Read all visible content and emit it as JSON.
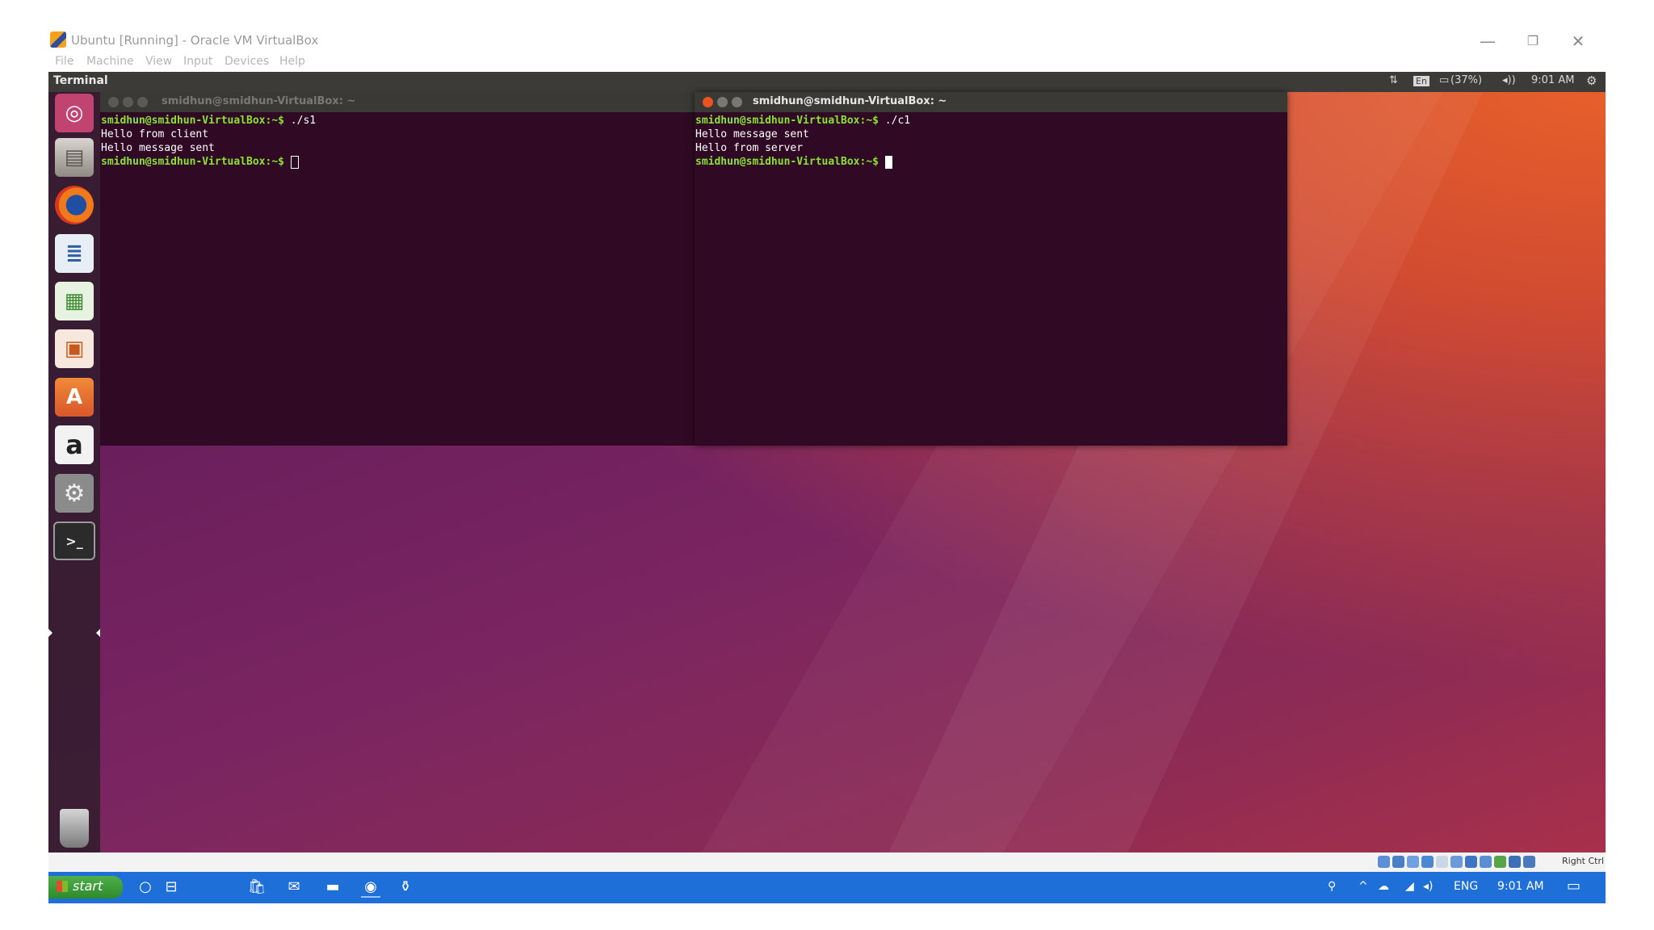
{
  "host_window": {
    "title": "Ubuntu [Running] - Oracle VM VirtualBox",
    "menu": [
      "File",
      "Machine",
      "View",
      "Input",
      "Devices",
      "Help"
    ],
    "controls": {
      "minimize": "—",
      "maximize": "❐",
      "close": "✕"
    }
  },
  "guest": {
    "topbar": {
      "app_title": "Terminal",
      "battery": "(37%)",
      "time": "9:01 AM"
    },
    "launcher": [
      "dash-home",
      "files",
      "firefox",
      "writer",
      "calc",
      "impress",
      "software-center",
      "amazon",
      "system-settings",
      "terminal",
      "trash"
    ],
    "terminals": [
      {
        "title": "smidhun@smidhun-VirtualBox: ~",
        "active": false,
        "lines": [
          {
            "prompt": "smidhun@smidhun-VirtualBox:~$",
            "cmd": " ./s1"
          },
          {
            "text": "Hello from client"
          },
          {
            "text": "Hello message sent"
          },
          {
            "prompt": "smidhun@smidhun-VirtualBox:~$",
            "cmd": " "
          }
        ]
      },
      {
        "title": "smidhun@smidhun-VirtualBox: ~",
        "active": true,
        "lines": [
          {
            "prompt": "smidhun@smidhun-VirtualBox:~$",
            "cmd": " ./c1"
          },
          {
            "text": "Hello message sent"
          },
          {
            "text": "Hello from server"
          },
          {
            "prompt": "smidhun@smidhun-VirtualBox:~$",
            "cmd": " "
          }
        ]
      }
    ]
  },
  "status_bar": {
    "host_key": "Right Ctrl"
  },
  "taskbar": {
    "start_label": "start",
    "tray": {
      "language": "ENG",
      "time": "9:01 AM"
    }
  },
  "colors": {
    "terminal_bg": "#300a24",
    "prompt": "#8ae234",
    "taskbar": "#1f6fd9"
  }
}
